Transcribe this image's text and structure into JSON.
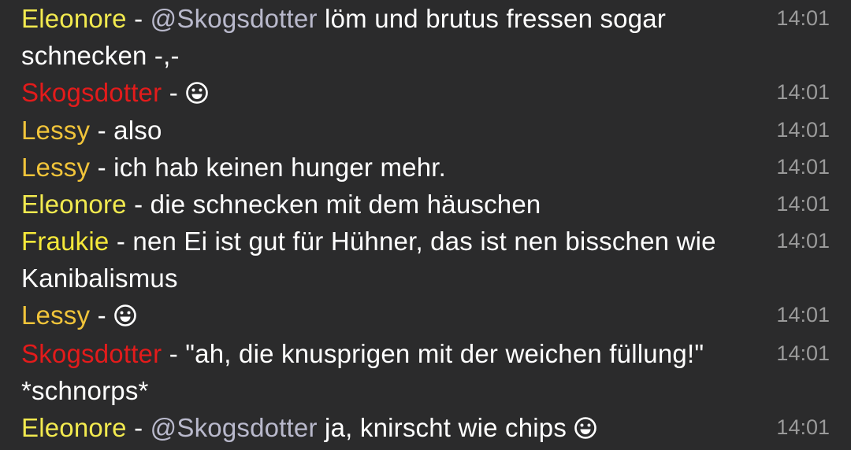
{
  "colors": {
    "background": "#2b2b2c",
    "message_text": "#ffffff",
    "timestamp": "#9a9a9a",
    "mention": "#b9b9cc",
    "user_Eleonore": "#f2ea4f",
    "user_Skogsdotter": "#e31b1b",
    "user_Lessy": "#f1c43a",
    "user_Fraukie": "#f6e93a"
  },
  "messages": [
    {
      "user": "Eleonore",
      "separator": "-",
      "mention": "@Skogsdotter",
      "text": "löm und brutus fressen sogar schnecken -,-",
      "emoji": "",
      "time": "14:01"
    },
    {
      "user": "Skogsdotter",
      "separator": "-",
      "mention": "",
      "text": "",
      "emoji": "smiley-icon",
      "time": "14:01"
    },
    {
      "user": "Lessy",
      "separator": "-",
      "mention": "",
      "text": "also",
      "emoji": "",
      "time": "14:01"
    },
    {
      "user": "Lessy",
      "separator": "-",
      "mention": "",
      "text": "ich hab keinen hunger mehr.",
      "emoji": "",
      "time": "14:01"
    },
    {
      "user": "Eleonore",
      "separator": "-",
      "mention": "",
      "text": "die schnecken mit dem häuschen",
      "emoji": "",
      "time": "14:01"
    },
    {
      "user": "Fraukie",
      "separator": "-",
      "mention": "",
      "text": "nen Ei ist gut für Hühner, das ist nen bisschen wie Kanibalismus",
      "emoji": "",
      "time": "14:01"
    },
    {
      "user": "Lessy",
      "separator": "-",
      "mention": "",
      "text": "",
      "emoji": "smiley-icon",
      "time": "14:01"
    },
    {
      "user": "Skogsdotter",
      "separator": "-",
      "mention": "",
      "text": "\"ah, die knusprigen mit der weichen füllung!\" *schnorps*",
      "emoji": "",
      "time": "14:01"
    },
    {
      "user": "Eleonore",
      "separator": "-",
      "mention": "@Skogsdotter",
      "text": "ja, knirscht wie chips",
      "emoji": "smiley-icon",
      "time": "14:01"
    }
  ]
}
